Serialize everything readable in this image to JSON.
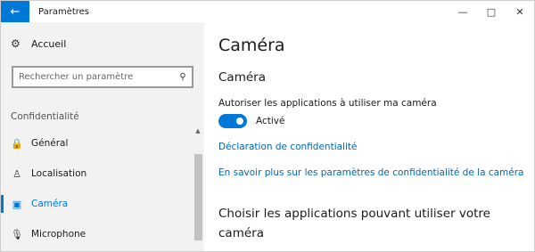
{
  "window": {
    "title": "Paramètres",
    "back_icon": "arrow-left-icon",
    "controls": [
      "minimize-icon",
      "maximize-icon",
      "close-icon"
    ]
  },
  "sidebar": {
    "home": {
      "icon": "gear-icon",
      "label": "Accueil"
    },
    "search": {
      "placeholder": "Rechercher un paramètre",
      "icon": "search-icon"
    },
    "section_header": "Confidentialité",
    "items": [
      {
        "icon": "lock-icon",
        "label": "Général",
        "active": false
      },
      {
        "icon": "person-location-icon",
        "label": "Localisation",
        "active": false
      },
      {
        "icon": "camera-icon",
        "label": "Caméra",
        "active": true
      },
      {
        "icon": "microphone-icon",
        "label": "Microphone",
        "active": false
      }
    ]
  },
  "main": {
    "page_title": "Caméra",
    "sub_title": "Caméra",
    "permission_text": "Autoriser les applications à utiliser ma caméra",
    "toggle": {
      "state": "on",
      "label": "Activé"
    },
    "links": [
      "Déclaration de confidentialité",
      "En savoir plus sur les paramètres de confidentialité de la caméra"
    ],
    "section_heading": "Choisir les applications pouvant utiliser votre caméra"
  },
  "colors": {
    "accent": "#0078d7",
    "link": "#0066b4",
    "sidebar_bg": "#f2f2f2"
  }
}
